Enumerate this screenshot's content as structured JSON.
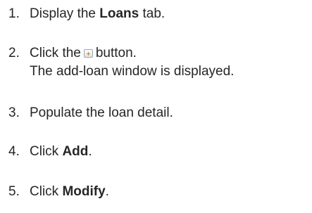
{
  "steps": [
    {
      "number": "1.",
      "before": "Display the ",
      "bold": "Loans",
      "after": " tab."
    },
    {
      "number": "2.",
      "before": "Click the",
      "icon": "add-icon",
      "after": "button.",
      "note": "The add-loan window is displayed."
    },
    {
      "number": "3.",
      "text": "Populate the loan detail."
    },
    {
      "number": "4.",
      "before": "Click ",
      "bold": "Add",
      "after": "."
    },
    {
      "number": "5.",
      "before": "Click ",
      "bold": "Modify",
      "after": "."
    }
  ]
}
